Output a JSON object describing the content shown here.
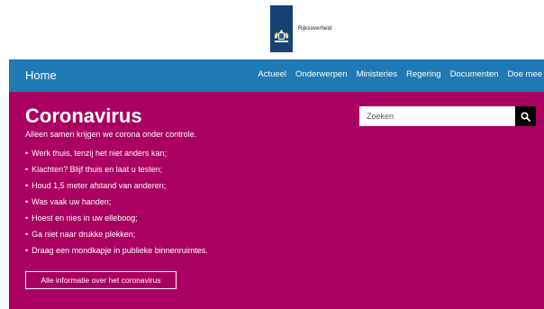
{
  "header": {
    "logo_text": "Rijksoverheid",
    "logo_icon": "coat-of-arms-icon",
    "brand_color": "#154273"
  },
  "nav": {
    "home_label": "Home",
    "items": [
      {
        "label": "Actueel"
      },
      {
        "label": "Onderwerpen"
      },
      {
        "label": "Ministeries"
      },
      {
        "label": "Regering"
      },
      {
        "label": "Documenten"
      },
      {
        "label": "Doe mee"
      }
    ],
    "background_color": "#1f79b5"
  },
  "hero": {
    "title": "Coronavirus",
    "intro": "Alleen samen krijgen we corona onder controle.",
    "bullets": [
      "Werk thuis, tenzij het niet anders kan;",
      "Klachten? Blijf thuis en laat u testen;",
      "Houd 1,5 meter afstand van anderen;",
      "Was vaak uw handen;",
      "Hoest en nies in uw elleboog;",
      "Ga niet naar drukke plekken;",
      "Draag een mondkapje in publieke binnenruimtes."
    ],
    "button_label": "Alle informatie over het coronavirus",
    "background_color": "#a90061"
  },
  "search": {
    "placeholder": "Zoeken",
    "value": "",
    "button_icon": "search-icon"
  }
}
